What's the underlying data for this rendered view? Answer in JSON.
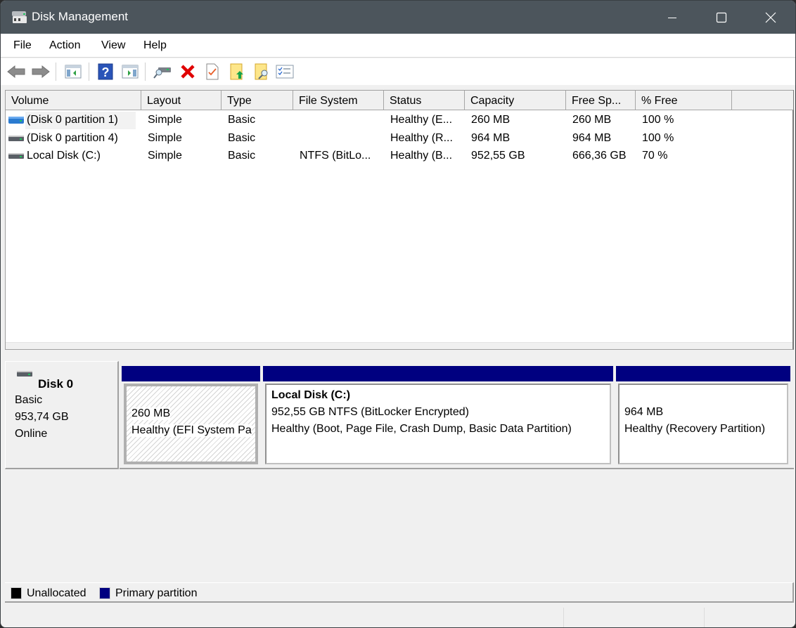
{
  "window": {
    "title": "Disk Management",
    "icon": "disk-management-icon",
    "controls": {
      "minimize": "minimize-icon",
      "maximize": "maximize-icon",
      "close": "close-icon"
    }
  },
  "menu": [
    "File",
    "Action",
    "View",
    "Help"
  ],
  "toolbar": [
    {
      "name": "back",
      "icon": "back-arrow-icon"
    },
    {
      "name": "forward",
      "icon": "forward-arrow-icon"
    },
    {
      "name": "show-hide-console-tree",
      "icon": "console-tree-icon"
    },
    {
      "name": "help",
      "icon": "help-icon"
    },
    {
      "name": "show-hide-action-pane",
      "icon": "action-pane-icon"
    },
    {
      "name": "connect-virtual-disk",
      "icon": "disk-search-icon"
    },
    {
      "name": "delete",
      "icon": "delete-icon"
    },
    {
      "name": "properties",
      "icon": "properties-check-icon"
    },
    {
      "name": "open",
      "icon": "folder-up-icon"
    },
    {
      "name": "explore",
      "icon": "folder-search-icon"
    },
    {
      "name": "settings-list",
      "icon": "checklist-icon"
    }
  ],
  "volume_table": {
    "columns": [
      "Volume",
      "Layout",
      "Type",
      "File System",
      "Status",
      "Capacity",
      "Free Sp...",
      "% Free"
    ],
    "rows": [
      {
        "volume": "(Disk 0 partition 1)",
        "layout": "Simple",
        "type": "Basic",
        "file_system": "",
        "status": "Healthy (E...",
        "capacity": "260 MB",
        "free_space": "260 MB",
        "percent_free": "100 %",
        "icon": "blue-volume-icon",
        "selected": true
      },
      {
        "volume": "(Disk 0 partition 4)",
        "layout": "Simple",
        "type": "Basic",
        "file_system": "",
        "status": "Healthy (R...",
        "capacity": "964 MB",
        "free_space": "964 MB",
        "percent_free": "100 %",
        "icon": "drive-icon",
        "selected": false
      },
      {
        "volume": "Local Disk (C:)",
        "layout": "Simple",
        "type": "Basic",
        "file_system": "NTFS (BitLo...",
        "status": "Healthy (B...",
        "capacity": "952,55 GB",
        "free_space": "666,36 GB",
        "percent_free": "70 %",
        "icon": "drive-icon",
        "selected": false
      }
    ]
  },
  "disk": {
    "name": "Disk 0",
    "type": "Basic",
    "size": "953,74 GB",
    "state": "Online",
    "partitions": [
      {
        "title": "",
        "line1": "260 MB",
        "line2": "Healthy (EFI System Pa",
        "style": "hatched"
      },
      {
        "title": "Local Disk  (C:)",
        "line1": "952,55 GB NTFS (BitLocker Encrypted)",
        "line2": "Healthy (Boot, Page File, Crash Dump, Basic Data Partition)",
        "style": "plain"
      },
      {
        "title": "",
        "line1": "964 MB",
        "line2": "Healthy (Recovery Partition)",
        "style": "plain"
      }
    ]
  },
  "legend": [
    {
      "label": "Unallocated",
      "color": "#000000"
    },
    {
      "label": "Primary partition",
      "color": "#000080"
    }
  ],
  "colors": {
    "titlebar": "#4c555c",
    "primary_partition": "#000080",
    "delete": "#e00000"
  }
}
